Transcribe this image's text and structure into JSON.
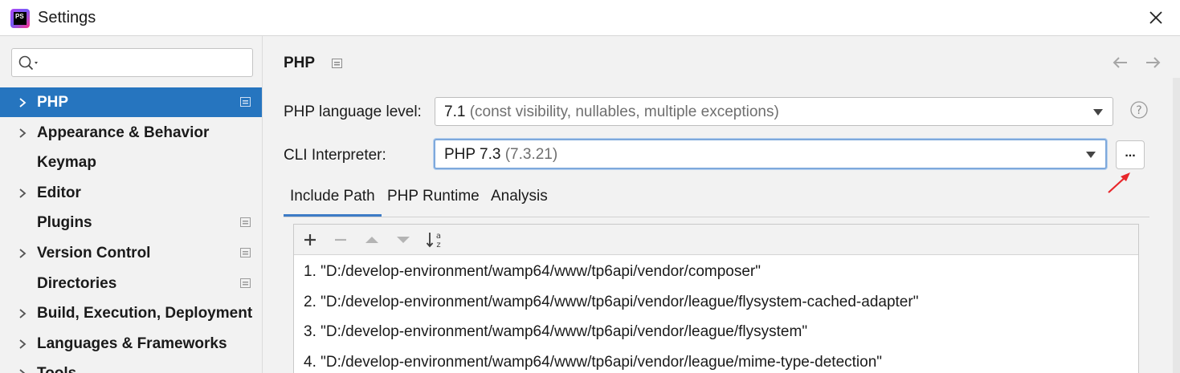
{
  "window": {
    "title": "Settings",
    "app_icon_text": "PS"
  },
  "sidebar": {
    "search_placeholder": "",
    "items": [
      {
        "label": "PHP",
        "has_chevron": true,
        "project_icon": true,
        "selected": true
      },
      {
        "label": "Appearance & Behavior",
        "has_chevron": true,
        "project_icon": false,
        "selected": false
      },
      {
        "label": "Keymap",
        "has_chevron": false,
        "project_icon": false,
        "selected": false
      },
      {
        "label": "Editor",
        "has_chevron": true,
        "project_icon": false,
        "selected": false
      },
      {
        "label": "Plugins",
        "has_chevron": false,
        "project_icon": true,
        "selected": false
      },
      {
        "label": "Version Control",
        "has_chevron": true,
        "project_icon": true,
        "selected": false
      },
      {
        "label": "Directories",
        "has_chevron": false,
        "project_icon": true,
        "selected": false
      },
      {
        "label": "Build, Execution, Deployment",
        "has_chevron": true,
        "project_icon": false,
        "selected": false
      },
      {
        "label": "Languages & Frameworks",
        "has_chevron": true,
        "project_icon": false,
        "selected": false
      },
      {
        "label": "Tools",
        "has_chevron": true,
        "project_icon": false,
        "selected": false
      }
    ]
  },
  "main": {
    "title": "PHP",
    "language_level": {
      "label": "PHP language level:",
      "value": "7.1",
      "detail": "(const visibility, nullables, multiple exceptions)"
    },
    "cli_interpreter": {
      "label": "CLI Interpreter:",
      "value": "PHP 7.3",
      "detail": "(7.3.21)",
      "browse_label": "..."
    },
    "tabs": [
      {
        "label": "Include Path",
        "active": true
      },
      {
        "label": "PHP Runtime",
        "active": false
      },
      {
        "label": "Analysis",
        "active": false
      }
    ],
    "include_paths": [
      "1. \"D:/develop-environment/wamp64/www/tp6api/vendor/composer\"",
      "2. \"D:/develop-environment/wamp64/www/tp6api/vendor/league/flysystem-cached-adapter\"",
      "3. \"D:/develop-environment/wamp64/www/tp6api/vendor/league/flysystem\"",
      "4. \"D:/develop-environment/wamp64/www/tp6api/vendor/league/mime-type-detection\""
    ]
  },
  "colors": {
    "selection": "#2675bf",
    "focus_border": "#7ea9dc",
    "annotation_arrow": "#e8262a"
  },
  "icons": {
    "close": "close-icon",
    "search": "search-icon",
    "back": "back-arrow-icon",
    "forward": "forward-arrow-icon",
    "help": "help-icon",
    "project_scope": "project-scope-icon"
  }
}
